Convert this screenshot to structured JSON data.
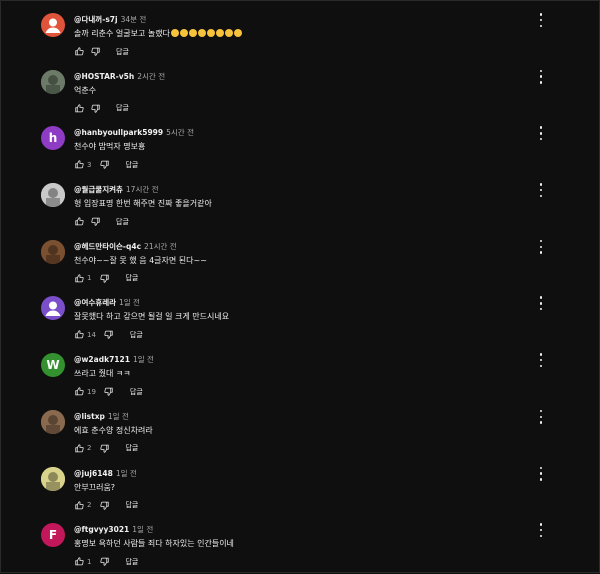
{
  "reply_label": "답글",
  "comments": [
    {
      "handle": "@다내꺼-s7j",
      "time": "34분 전",
      "text": "솔까  리춘수 얼굴보고 놀랬다",
      "emoji_count": 8,
      "likes": "",
      "avatar": {
        "type": "default",
        "color": "#e0543b"
      }
    },
    {
      "handle": "@HOSTAR-v5h",
      "time": "2시간 전",
      "text": "억춘수",
      "likes": "",
      "avatar": {
        "type": "photo",
        "color": "#6b7b68"
      }
    },
    {
      "handle": "@hanbyoullpark5999",
      "time": "5시간 전",
      "text": "천수야 밥먹자 명보횽",
      "likes": "3",
      "avatar": {
        "type": "letter",
        "letter": "h",
        "color": "#8e3cc4"
      }
    },
    {
      "handle": "@월급쿨지켜츄",
      "time": "17시간 전",
      "text": "형 입장표명 한번 해주면 진짜 좋을거같아",
      "likes": "",
      "avatar": {
        "type": "photo",
        "color": "#c9c9c9"
      }
    },
    {
      "handle": "@헤드만타이슨-q4c",
      "time": "21시간 전",
      "text": "천수야~~잘 못 했 음 4글자면 된다~~",
      "likes": "1",
      "avatar": {
        "type": "photo",
        "color": "#7a5030"
      }
    },
    {
      "handle": "@여수휴레라",
      "time": "1일 전",
      "text": "잘못했다 하고 갚으면 될걸 일 크게 만드시네요",
      "likes": "14",
      "avatar": {
        "type": "default",
        "color": "#7b4fc9"
      }
    },
    {
      "handle": "@w2adk7121",
      "time": "1일 전",
      "text": "쓰라고 줬대 ㅋㅋ",
      "likes": "19",
      "avatar": {
        "type": "letter",
        "letter": "W",
        "color": "#33912f"
      }
    },
    {
      "handle": "@listxp",
      "time": "1일 전",
      "text": "에효 춘수양 정신차려라",
      "likes": "2",
      "avatar": {
        "type": "photo",
        "color": "#8a6a4f"
      }
    },
    {
      "handle": "@juj6148",
      "time": "1일 전",
      "text": "안부끄러움?",
      "likes": "2",
      "avatar": {
        "type": "photo",
        "color": "#d9d28a"
      }
    },
    {
      "handle": "@ftgvyy3021",
      "time": "1일 전",
      "text": "홍명보 욕하던 사람들 죄다 하자있는 인간들이네",
      "likes": "1",
      "avatar": {
        "type": "letter",
        "letter": "F",
        "color": "#c2185b"
      }
    }
  ]
}
